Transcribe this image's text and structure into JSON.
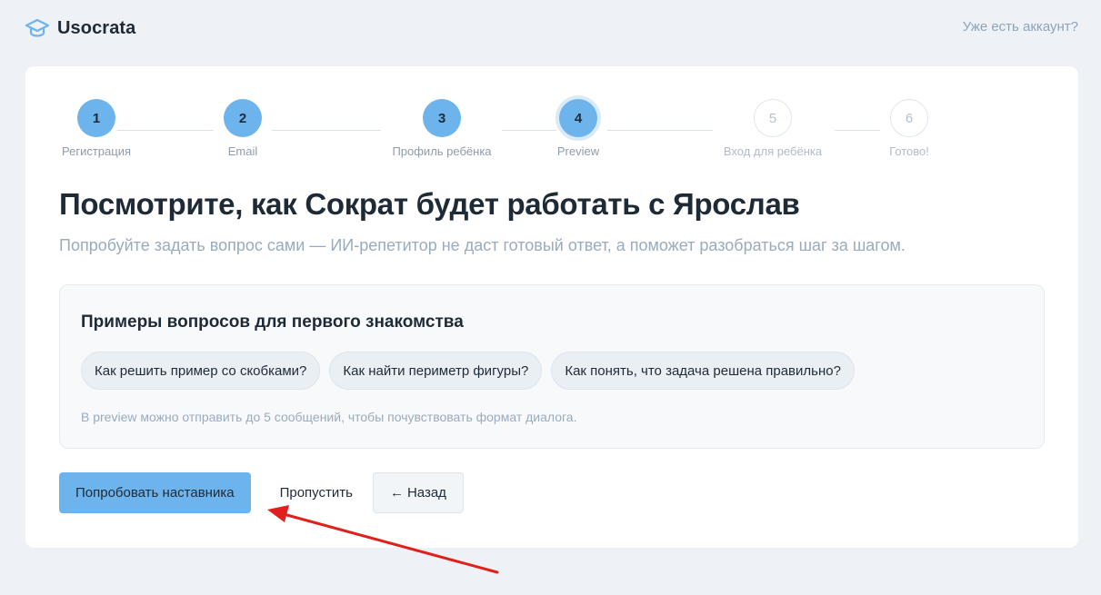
{
  "header": {
    "brand": "Usocrata",
    "login_link": "Уже есть аккаунт?"
  },
  "stepper": {
    "steps": [
      {
        "number": "1",
        "label": "Регистрация",
        "state": "done"
      },
      {
        "number": "2",
        "label": "Email",
        "state": "done"
      },
      {
        "number": "3",
        "label": "Профиль ребёнка",
        "state": "done"
      },
      {
        "number": "4",
        "label": "Preview",
        "state": "current"
      },
      {
        "number": "5",
        "label": "Вход для ребёнка",
        "state": "future"
      },
      {
        "number": "6",
        "label": "Готово!",
        "state": "future"
      }
    ]
  },
  "main": {
    "title": "Посмотрите, как Сократ будет работать с Ярослав",
    "subtitle": "Попробуйте задать вопрос сами — ИИ-репетитор не даст готовый ответ, а поможет разобраться шаг за шагом."
  },
  "examples": {
    "title": "Примеры вопросов для первого знакомства",
    "chips": [
      "Как решить пример со скобками?",
      "Как найти периметр фигуры?",
      "Как понять, что задача решена правильно?"
    ],
    "note": "В preview можно отправить до 5 сообщений, чтобы почувствовать формат диалога."
  },
  "actions": {
    "primary_label": "Попробовать наставника",
    "skip_label": "Пропустить",
    "back_arrow": "←",
    "back_label": "Назад"
  },
  "colors": {
    "accent": "#6eb4ec",
    "background": "#eef2f6",
    "annotation_arrow": "#e0201c"
  },
  "icons": {
    "logo": "graduation-cap-icon"
  }
}
